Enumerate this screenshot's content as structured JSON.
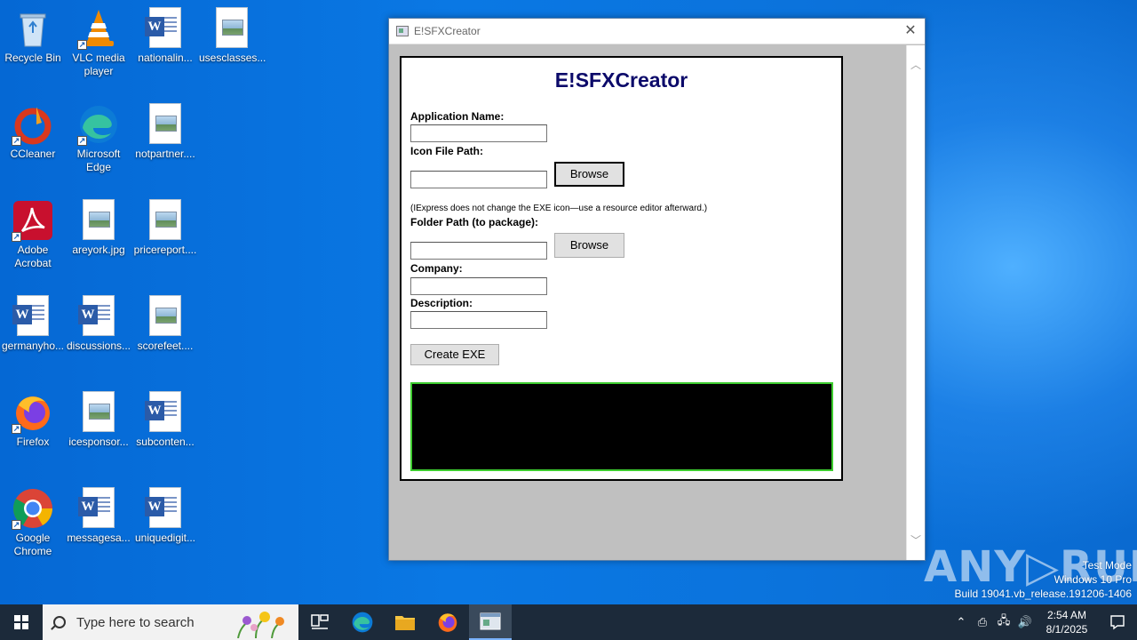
{
  "desktop": {
    "icons": [
      {
        "label": "Recycle Bin"
      },
      {
        "label": "VLC media player"
      },
      {
        "label": "nationalin..."
      },
      {
        "label": "usesclasses..."
      },
      {
        "label": "CCleaner"
      },
      {
        "label": "Microsoft Edge"
      },
      {
        "label": "notpartner...."
      },
      {
        "label": "Adobe Acrobat"
      },
      {
        "label": "areyork.jpg"
      },
      {
        "label": "pricereport...."
      },
      {
        "label": "germanyho..."
      },
      {
        "label": "discussions..."
      },
      {
        "label": "scorefeet...."
      },
      {
        "label": "Firefox"
      },
      {
        "label": "icesponsor..."
      },
      {
        "label": "subconten..."
      },
      {
        "label": "Google Chrome"
      },
      {
        "label": "messagesa..."
      },
      {
        "label": "uniquedigit..."
      }
    ]
  },
  "window": {
    "title": "E!SFXCreator",
    "close_glyph": "✕"
  },
  "app": {
    "heading": "E!SFXCreator",
    "app_name_label": "Application Name:",
    "app_name_value": "",
    "icon_path_label": "Icon File Path:",
    "icon_path_value": "",
    "browse_icon_label": "Browse",
    "icon_note": "(IExpress does not change the EXE icon—use a resource editor afterward.)",
    "folder_path_label": "Folder Path (to package):",
    "folder_path_value": "",
    "browse_folder_label": "Browse",
    "company_label": "Company:",
    "company_value": "",
    "description_label": "Description:",
    "description_value": "",
    "create_button_label": "Create EXE"
  },
  "watermark": {
    "line1": "Test Mode",
    "line2": "Windows 10 Pro",
    "line3": "Build 19041.vb_release.191206-1406",
    "brand": "ANY▷RUN"
  },
  "taskbar": {
    "search_placeholder": "Type here to search",
    "time": "2:54 AM",
    "date": "8/1/2025"
  }
}
